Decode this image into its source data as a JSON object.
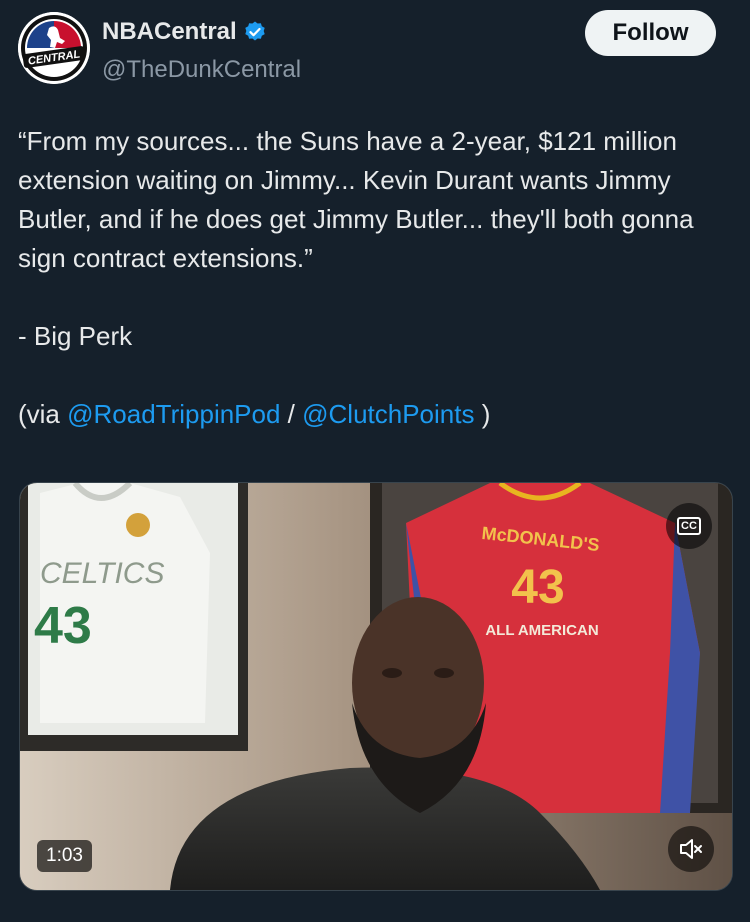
{
  "author": {
    "display_name": "NBACentral",
    "handle": "@TheDunkCentral",
    "avatar_text": "CENTRAL",
    "verified_icon": "verified-badge-icon",
    "verified_color": "#1d9bf0"
  },
  "follow_button": {
    "label": "Follow"
  },
  "tweet": {
    "quote": "“From my sources... the Suns have a 2-year, $121 million extension waiting on Jimmy... Kevin Durant wants Jimmy Butler, and if he does get Jimmy Butler... they'll both gonna sign contract extensions.”",
    "attribution": "- Big Perk",
    "via_prefix": "(via ",
    "mention_1": "@RoadTrippinPod",
    "separator": " / ",
    "mention_2": "@ClutchPoints",
    "via_suffix": " )"
  },
  "video": {
    "duration": "1:03",
    "cc_label": "CC",
    "cc_icon": "closed-captions-icon",
    "mute_icon": "speaker-muted-icon",
    "jersey_left": {
      "team": "CELTICS",
      "number": "43"
    },
    "jersey_right": {
      "brand": "McDONALD'S",
      "number": "43",
      "caption": "ALL AMERICAN"
    }
  },
  "colors": {
    "background": "#15202b",
    "text": "#e7e9ea",
    "secondary_text": "#8b98a5",
    "link": "#1d9bf0"
  }
}
